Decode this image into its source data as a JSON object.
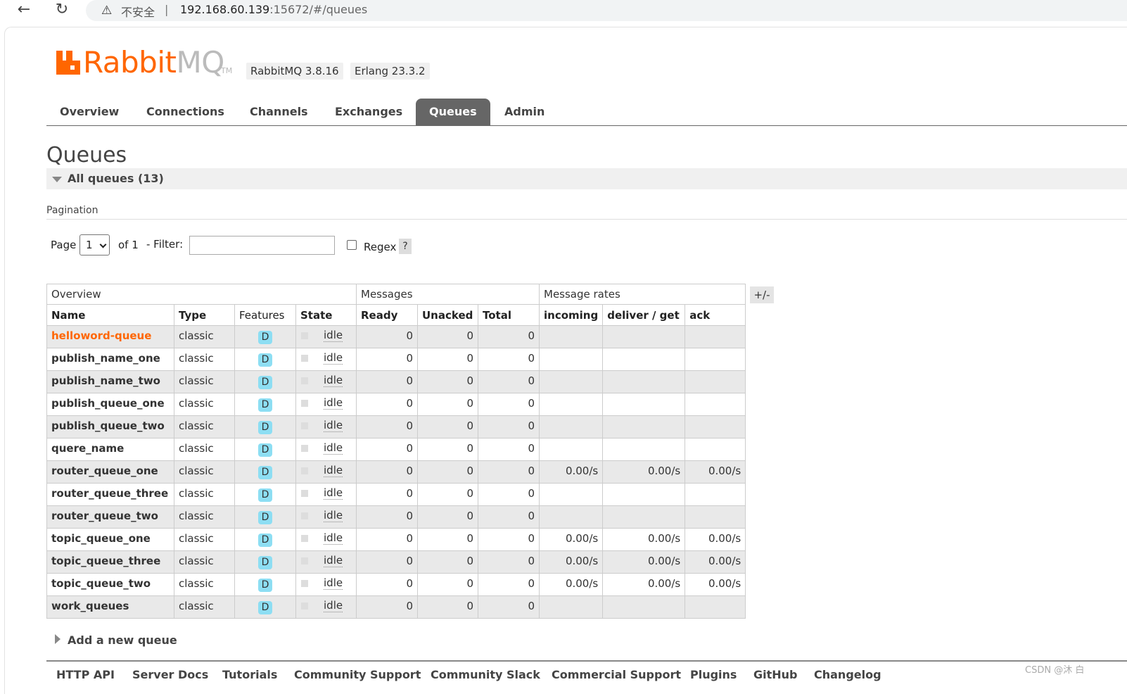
{
  "browser": {
    "back_icon": "arrow-left-icon",
    "reload_icon": "reload-icon",
    "security_warning": "不安全",
    "url_host": "192.168.60.139",
    "url_path": ":15672/#/queues"
  },
  "brand": {
    "logo_rabbit": "Rabbit",
    "logo_mq": "MQ",
    "logo_tm": "TM",
    "rabbitmq_version": "RabbitMQ 3.8.16",
    "erlang_version": "Erlang 23.3.2",
    "accent_color": "#ff6600"
  },
  "tabs": [
    {
      "label": "Overview"
    },
    {
      "label": "Connections"
    },
    {
      "label": "Channels"
    },
    {
      "label": "Exchanges"
    },
    {
      "label": "Queues",
      "active": true
    },
    {
      "label": "Admin"
    }
  ],
  "page": {
    "title": "Queues",
    "section_title": "All queues (13)"
  },
  "pagination": {
    "heading": "Pagination",
    "page_label": "Page",
    "page_value": "1",
    "of_label": "of 1",
    "filter_label": "- Filter:",
    "filter_value": "",
    "regex_label": "Regex",
    "regex_checked": false,
    "help": "?"
  },
  "table": {
    "groups": [
      "Overview",
      "Messages",
      "Message rates"
    ],
    "columns": [
      "Name",
      "Type",
      "Features",
      "State",
      "Ready",
      "Unacked",
      "Total",
      "incoming",
      "deliver / get",
      "ack"
    ],
    "toggle_columns": "+/-",
    "rows": [
      {
        "name": "helloword-queue",
        "type": "classic",
        "feature": "D",
        "state": "idle",
        "ready": "0",
        "unacked": "0",
        "total": "0",
        "incoming": "",
        "deliver": "",
        "ack": ""
      },
      {
        "name": "publish_name_one",
        "type": "classic",
        "feature": "D",
        "state": "idle",
        "ready": "0",
        "unacked": "0",
        "total": "0",
        "incoming": "",
        "deliver": "",
        "ack": ""
      },
      {
        "name": "publish_name_two",
        "type": "classic",
        "feature": "D",
        "state": "idle",
        "ready": "0",
        "unacked": "0",
        "total": "0",
        "incoming": "",
        "deliver": "",
        "ack": ""
      },
      {
        "name": "publish_queue_one",
        "type": "classic",
        "feature": "D",
        "state": "idle",
        "ready": "0",
        "unacked": "0",
        "total": "0",
        "incoming": "",
        "deliver": "",
        "ack": ""
      },
      {
        "name": "publish_queue_two",
        "type": "classic",
        "feature": "D",
        "state": "idle",
        "ready": "0",
        "unacked": "0",
        "total": "0",
        "incoming": "",
        "deliver": "",
        "ack": ""
      },
      {
        "name": "quere_name",
        "type": "classic",
        "feature": "D",
        "state": "idle",
        "ready": "0",
        "unacked": "0",
        "total": "0",
        "incoming": "",
        "deliver": "",
        "ack": ""
      },
      {
        "name": "router_queue_one",
        "type": "classic",
        "feature": "D",
        "state": "idle",
        "ready": "0",
        "unacked": "0",
        "total": "0",
        "incoming": "0.00/s",
        "deliver": "0.00/s",
        "ack": "0.00/s"
      },
      {
        "name": "router_queue_three",
        "type": "classic",
        "feature": "D",
        "state": "idle",
        "ready": "0",
        "unacked": "0",
        "total": "0",
        "incoming": "",
        "deliver": "",
        "ack": ""
      },
      {
        "name": "router_queue_two",
        "type": "classic",
        "feature": "D",
        "state": "idle",
        "ready": "0",
        "unacked": "0",
        "total": "0",
        "incoming": "",
        "deliver": "",
        "ack": ""
      },
      {
        "name": "topic_queue_one",
        "type": "classic",
        "feature": "D",
        "state": "idle",
        "ready": "0",
        "unacked": "0",
        "total": "0",
        "incoming": "0.00/s",
        "deliver": "0.00/s",
        "ack": "0.00/s"
      },
      {
        "name": "topic_queue_three",
        "type": "classic",
        "feature": "D",
        "state": "idle",
        "ready": "0",
        "unacked": "0",
        "total": "0",
        "incoming": "0.00/s",
        "deliver": "0.00/s",
        "ack": "0.00/s"
      },
      {
        "name": "topic_queue_two",
        "type": "classic",
        "feature": "D",
        "state": "idle",
        "ready": "0",
        "unacked": "0",
        "total": "0",
        "incoming": "0.00/s",
        "deliver": "0.00/s",
        "ack": "0.00/s"
      },
      {
        "name": "work_queues",
        "type": "classic",
        "feature": "D",
        "state": "idle",
        "ready": "0",
        "unacked": "0",
        "total": "0",
        "incoming": "",
        "deliver": "",
        "ack": ""
      }
    ]
  },
  "add_queue_label": "Add a new queue",
  "footer": {
    "links": [
      "HTTP API",
      "Server Docs",
      "Tutorials",
      "Community Support",
      "Community Slack",
      "Commercial Support",
      "Plugins",
      "GitHub",
      "Changelog"
    ]
  },
  "watermark": "CSDN @沐    白"
}
